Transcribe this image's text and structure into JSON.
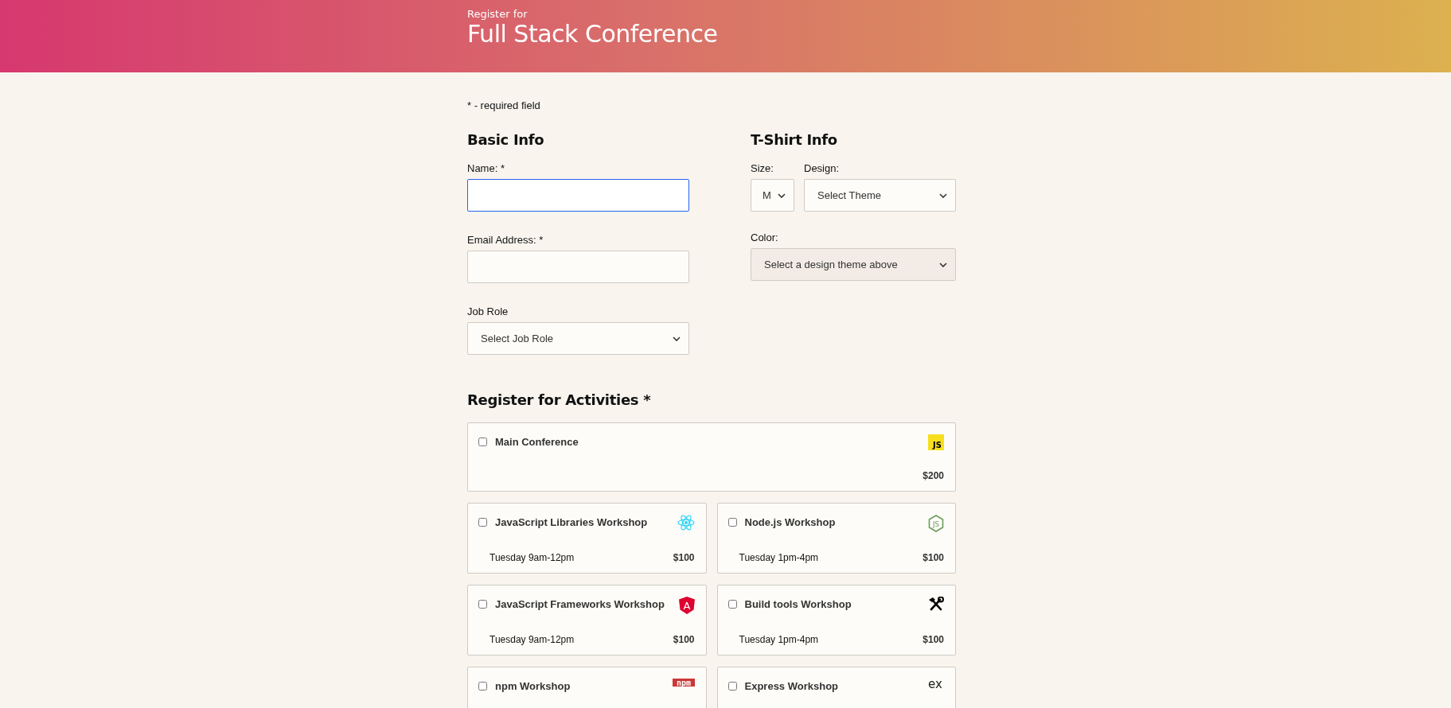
{
  "header": {
    "subtitle": "Register for",
    "title": "Full Stack Conference"
  },
  "required_note": "* - required field",
  "basic_info": {
    "heading": "Basic Info",
    "fields": [
      {
        "kind": "text",
        "label": "Name: *",
        "focused": true
      },
      {
        "kind": "text",
        "label": "Email Address: *",
        "focused": false
      },
      {
        "kind": "select",
        "label": "Job Role",
        "value": "Select Job Role"
      }
    ]
  },
  "tshirt": {
    "heading": "T-Shirt Info",
    "size": {
      "label": "Size:",
      "value": "M"
    },
    "design": {
      "label": "Design:",
      "value": "Select Theme"
    },
    "color": {
      "label": "Color:",
      "value": "Select a design theme above",
      "disabled": true
    }
  },
  "activities": {
    "heading": "Register for Activities *",
    "items": [
      {
        "kind": "main",
        "title": "Main Conference",
        "price": "$200",
        "checked": false,
        "icon": {
          "kind": "js",
          "text": "JS"
        }
      },
      {
        "kind": "workshop",
        "title": "JavaScript Libraries Workshop",
        "time": "Tuesday 9am-12pm",
        "price": "$100",
        "checked": false,
        "icon": {
          "kind": "atom"
        }
      },
      {
        "kind": "workshop",
        "title": "Node.js Workshop",
        "time": "Tuesday 1pm-4pm",
        "price": "$100",
        "checked": false,
        "icon": {
          "kind": "hexagon",
          "text": "JS"
        }
      },
      {
        "kind": "workshop",
        "title": "JavaScript Frameworks Workshop",
        "time": "Tuesday 9am-12pm",
        "price": "$100",
        "checked": false,
        "icon": {
          "kind": "shield",
          "text": "A"
        }
      },
      {
        "kind": "workshop",
        "title": "Build tools Workshop",
        "time": "Tuesday 1pm-4pm",
        "price": "$100",
        "checked": false,
        "icon": {
          "kind": "tools"
        }
      },
      {
        "kind": "workshop",
        "title": "npm Workshop",
        "checked": false,
        "icon": {
          "kind": "npm",
          "text": "npm"
        }
      },
      {
        "kind": "workshop",
        "title": "Express Workshop",
        "checked": false,
        "icon": {
          "kind": "plain",
          "text": "ex"
        }
      }
    ]
  }
}
